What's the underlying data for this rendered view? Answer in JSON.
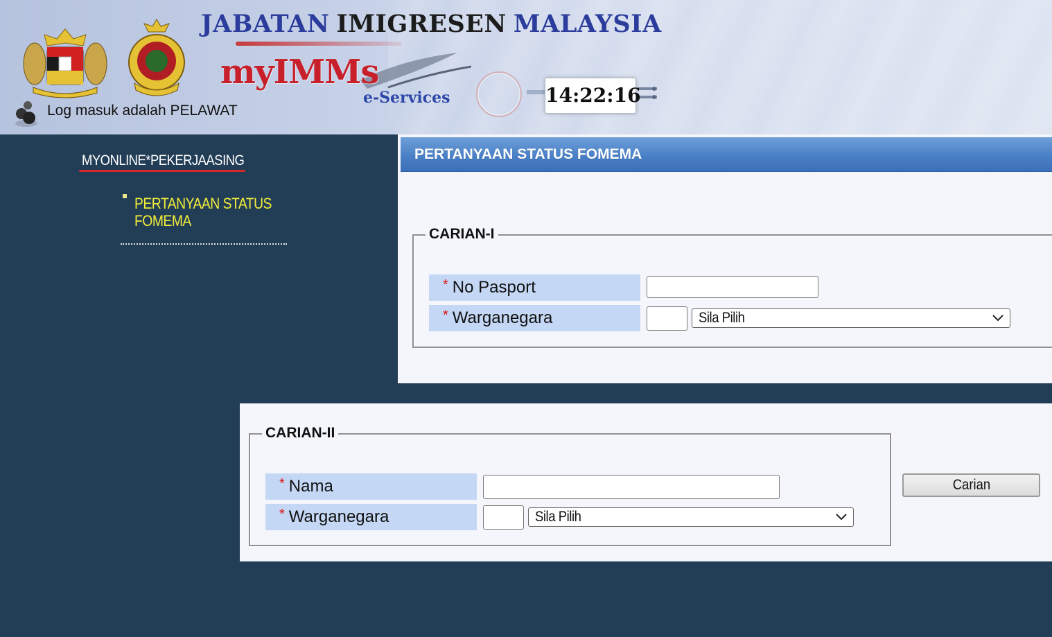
{
  "header": {
    "title_words": [
      "JABATAN",
      "IMIGRESEN",
      "MALAYSIA"
    ],
    "brand": "myIMMs",
    "brand_sub": "e-Services",
    "clock": "14:22:16",
    "login_status": "Log masuk adalah PELAWAT"
  },
  "nav": {
    "heading": "MYONLINE*PEKERJAASING",
    "items": [
      {
        "label": "PERTANYAAN STATUS FOMEMA"
      }
    ]
  },
  "panel": {
    "title": "PERTANYAAN STATUS FOMEMA"
  },
  "search1": {
    "legend": "CARIAN-I",
    "required_mark": "*",
    "passport_label": "No Pasport",
    "passport_value": "",
    "nationality_label": "Warganegara",
    "nationality_code": "",
    "nationality_select": "Sila Pilih"
  },
  "search2": {
    "legend": "CARIAN-II",
    "required_mark": "*",
    "name_label": "Nama",
    "name_value": "",
    "nationality_label": "Warganegara",
    "nationality_code": "",
    "nationality_select": "Sila Pilih",
    "button_label": "Carian"
  },
  "colors": {
    "page_bg": "#223d56",
    "title_bar": "#4a80c6",
    "label_bg": "#c4d8f5",
    "nav_active": "#f2ee3a",
    "required": "#dd1111",
    "brand_red": "#c8202a",
    "brand_blue": "#2b3c9c"
  }
}
